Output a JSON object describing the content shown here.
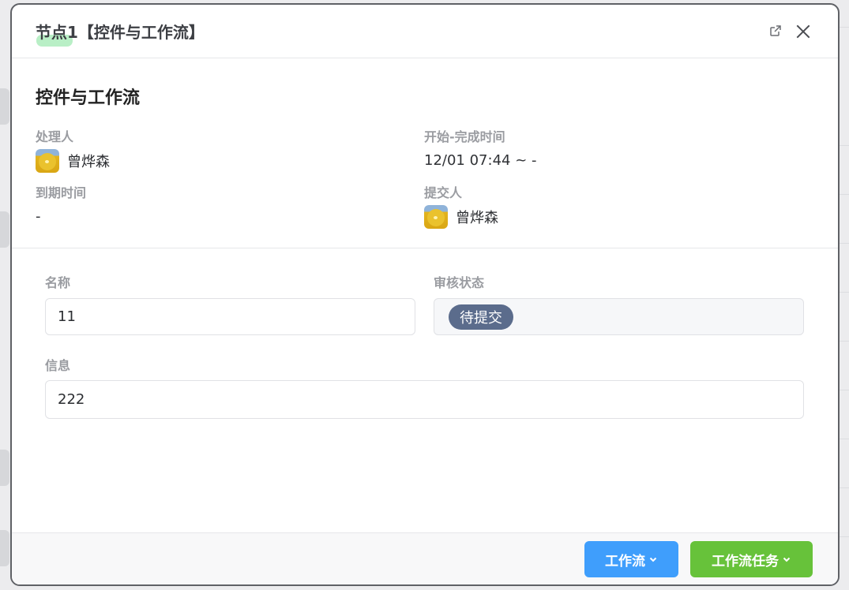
{
  "dialog": {
    "title": "节点1【控件与工作流】"
  },
  "header_icons": [
    "external-link-icon",
    "close-icon"
  ],
  "section": {
    "title": "控件与工作流"
  },
  "meta": {
    "assignee_label": "处理人",
    "assignee_name": "曾烨森",
    "start_end_label": "开始-完成时间",
    "start_end_value": "12/01 07:44 ~ -",
    "due_label": "到期时间",
    "due_value": "-",
    "submitter_label": "提交人",
    "submitter_name": "曾烨森"
  },
  "form": {
    "name_label": "名称",
    "name_value": "11",
    "status_label": "审核状态",
    "status_value": "待提交",
    "info_label": "信息",
    "info_value": "222"
  },
  "footer": {
    "workflow_button": "工作流",
    "workflow_task_button": "工作流任务"
  },
  "colors": {
    "primary": "#3f9efc",
    "success": "#67c23a",
    "status_tag": "#5b6c8c"
  }
}
